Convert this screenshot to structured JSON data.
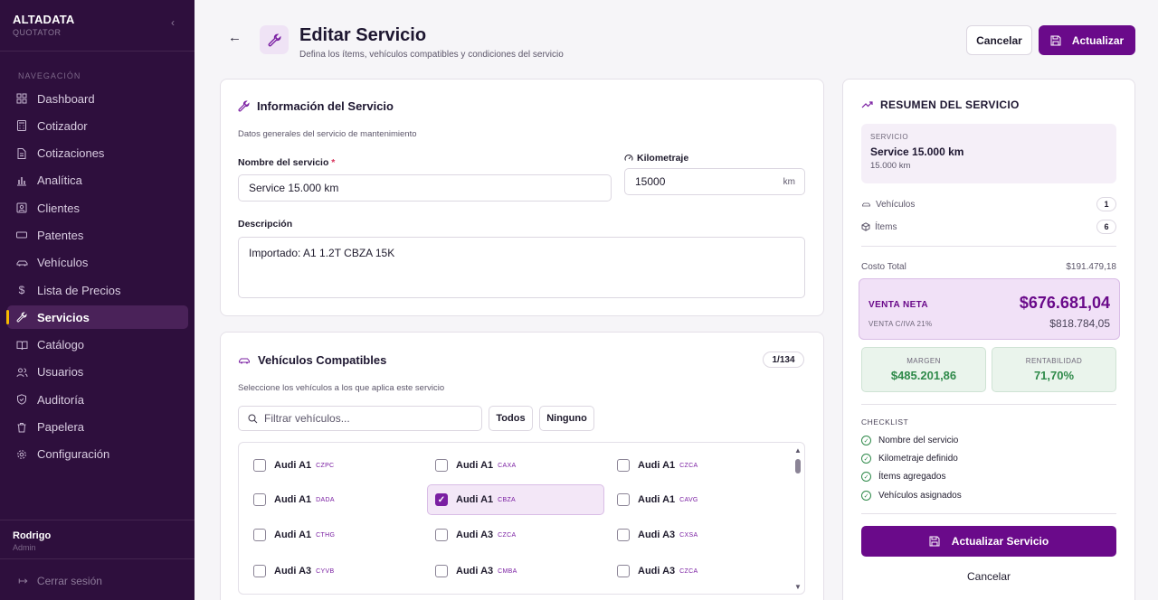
{
  "sidebar": {
    "brand": "ALTADATA",
    "brand_sub": "QUOTATOR",
    "nav_heading": "NAVEGACIÓN",
    "items": [
      {
        "label": "Dashboard",
        "icon": "dashboard-icon"
      },
      {
        "label": "Cotizador",
        "icon": "calculator-icon"
      },
      {
        "label": "Cotizaciones",
        "icon": "document-icon"
      },
      {
        "label": "Analítica",
        "icon": "bar-chart-icon"
      },
      {
        "label": "Clientes",
        "icon": "contact-icon"
      },
      {
        "label": "Patentes",
        "icon": "plate-icon"
      },
      {
        "label": "Vehículos",
        "icon": "car-icon"
      },
      {
        "label": "Lista de Precios",
        "icon": "dollar-icon"
      },
      {
        "label": "Servicios",
        "icon": "wrench-icon",
        "active": true
      },
      {
        "label": "Catálogo",
        "icon": "book-icon"
      },
      {
        "label": "Usuarios",
        "icon": "users-icon"
      },
      {
        "label": "Auditoría",
        "icon": "shield-icon"
      },
      {
        "label": "Papelera",
        "icon": "trash-icon"
      },
      {
        "label": "Configuración",
        "icon": "gear-icon"
      }
    ],
    "user": {
      "name": "Rodrigo",
      "role": "Admin"
    },
    "logout": "Cerrar sesión"
  },
  "header": {
    "title": "Editar Servicio",
    "subtitle": "Defina los ítems, vehículos compatibles y condiciones del servicio",
    "cancel": "Cancelar",
    "update": "Actualizar"
  },
  "info": {
    "title": "Información del Servicio",
    "description": "Datos generales del servicio de mantenimiento",
    "name_label": "Nombre del servicio",
    "name_required": "*",
    "name_value": "Service 15.000 km",
    "km_label": "Kilometraje",
    "km_value": "15000",
    "km_unit": "km",
    "desc_label": "Descripción",
    "desc_value": "Importado: A1 1.2T CBZA 15K"
  },
  "vehicles": {
    "title": "Vehículos Compatibles",
    "count": "1/134",
    "description": "Seleccione los vehículos a los que aplica este servicio",
    "filter_placeholder": "Filtrar vehículos...",
    "all": "Todos",
    "none": "Ninguno",
    "items": [
      {
        "model": "Audi A1",
        "code": "CZPC",
        "selected": false
      },
      {
        "model": "Audi A1",
        "code": "CAXA",
        "selected": false
      },
      {
        "model": "Audi A1",
        "code": "CZCA",
        "selected": false
      },
      {
        "model": "Audi A1",
        "code": "DADA",
        "selected": false
      },
      {
        "model": "Audi A1",
        "code": "CBZA",
        "selected": true
      },
      {
        "model": "Audi A1",
        "code": "CAVG",
        "selected": false
      },
      {
        "model": "Audi A1",
        "code": "CTHG",
        "selected": false
      },
      {
        "model": "Audi A3",
        "code": "CZCA",
        "selected": false
      },
      {
        "model": "Audi A3",
        "code": "CXSA",
        "selected": false
      },
      {
        "model": "Audi A3",
        "code": "CYVB",
        "selected": false
      },
      {
        "model": "Audi A3",
        "code": "CMBA",
        "selected": false
      },
      {
        "model": "Audi A3",
        "code": "CZCA",
        "selected": false
      }
    ]
  },
  "summary": {
    "title": "RESUMEN DEL SERVICIO",
    "service_label": "SERVICIO",
    "service_name": "Service 15.000 km",
    "service_km": "15.000 km",
    "vehicles_label": "Vehículos",
    "vehicles_count": "1",
    "items_label": "Ítems",
    "items_count": "6",
    "cost_label": "Costo Total",
    "cost_value": "$191.479,18",
    "net_label": "VENTA NETA",
    "net_value": "$676.681,04",
    "iva_label": "VENTA C/IVA 21%",
    "iva_value": "$818.784,05",
    "margin_label": "MARGEN",
    "margin_value": "$485.201,86",
    "profit_label": "RENTABILIDAD",
    "profit_value": "71,70%",
    "checklist_heading": "CHECKLIST",
    "checklist": [
      "Nombre del servicio",
      "Kilometraje definido",
      "Ítems agregados",
      "Vehículos asignados"
    ],
    "update_button": "Actualizar Servicio",
    "cancel_button": "Cancelar"
  },
  "colors": {
    "sidebar_bg": "#2e0f3d",
    "accent": "#6a0a8a",
    "active_marker": "#f5b800",
    "success": "#2f8a4a"
  }
}
